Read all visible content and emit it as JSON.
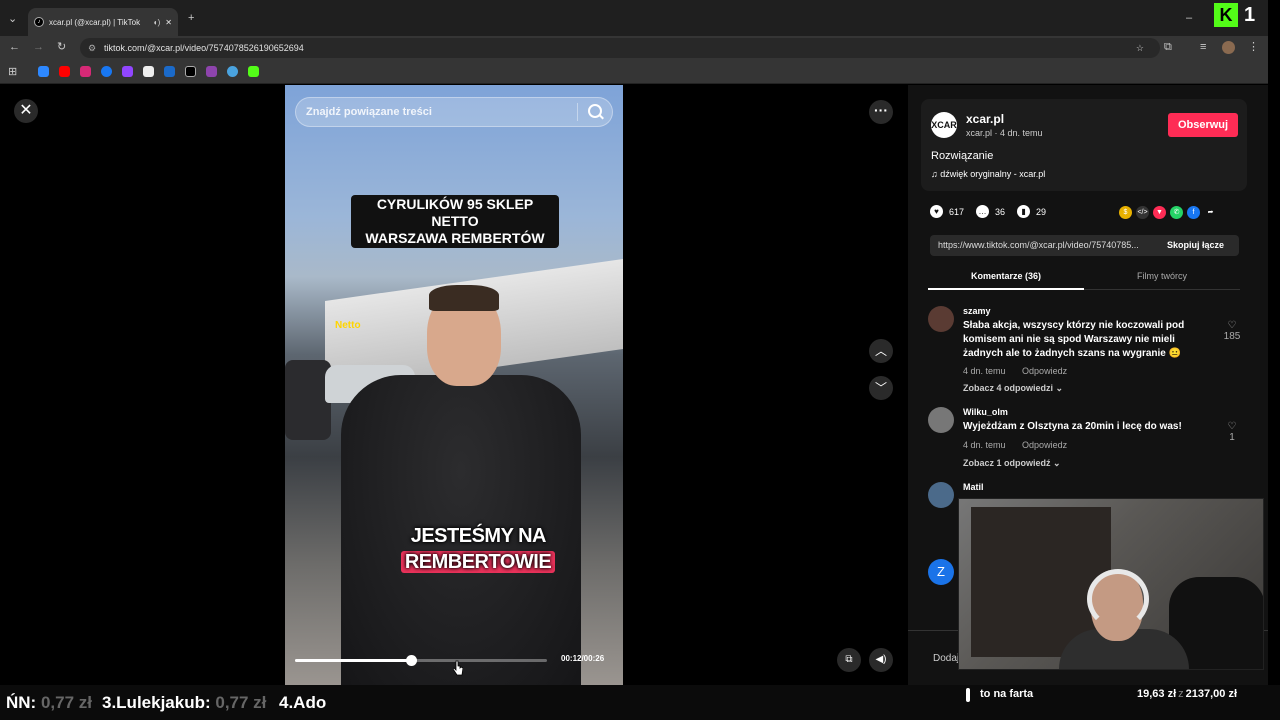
{
  "browser": {
    "tab_title": "xcar.pl (@xcar.pl) | TikTok",
    "url": "tiktok.com/@xcar.pl/video/7574078526190652694",
    "window_buttons": {
      "minimize": "–",
      "close": "✕"
    },
    "new_tab": "+",
    "overlay_logo": "K",
    "overlay_number": "1"
  },
  "video": {
    "search_placeholder": "Znajdź powiązane treści",
    "caption_top": "CYRULIKÓW 95 SKLEP NETTO\nWARSZAWA REMBERTÓW",
    "caption_bottom_a": "JESTEŚMY NA",
    "caption_bottom_b": "REMBERTOWIE",
    "store_sign": "Netto",
    "timecode": "00:12/00:26",
    "progress": 0.46
  },
  "panel": {
    "author_avatar_text": "XCAR",
    "author_name": "xcar.pl",
    "author_meta": "xcar.pl · 4 dn. temu",
    "follow_label": "Obserwuj",
    "description": "Rozwiązanie",
    "music": "♫  dźwięk oryginalny - xcar.pl",
    "likes": "617",
    "comments_count": "36",
    "saves": "29",
    "link": "https://www.tiktok.com/@xcar.pl/video/75740785...",
    "copy_link_label": "Skopiuj łącze",
    "tab_comments": "Komentarze (36)",
    "tab_creator": "Filmy twórcy",
    "comments": [
      {
        "user": "szamy",
        "text": "Słaba akcja, wszyscy którzy nie koczowali pod komisem ani nie są spod Warszawy nie mieli żadnych ale to żadnych szans na wygranie 😐",
        "time": "4 dn. temu",
        "reply": "Odpowiedz",
        "replies": "Zobacz 4 odpowiedzi ⌄",
        "likes": "185"
      },
      {
        "user": "Wilku_olm",
        "text": "Wyjeżdżam z Olsztyna za 20min i lecę do was!",
        "time": "4 dn. temu",
        "reply": "Odpowiedz",
        "replies": "Zobacz 1 odpowiedź ⌄",
        "likes": "1"
      },
      {
        "user": "Matil"
      }
    ],
    "z_avatar": "Z",
    "add_comment": "Dodaj"
  },
  "stream_overlay": {
    "leaderboard": [
      {
        "name": "ŃN:",
        "amount": "0,77 zł"
      },
      {
        "name": "3.Lulekjakub:",
        "amount": "0,77 zł"
      },
      {
        "name": "4.Ado",
        "amount": ""
      }
    ],
    "goal_label": "to na farta",
    "goal_current": "19,63 zł",
    "goal_sep": "z",
    "goal_target": "2137,00 zł"
  },
  "colors": {
    "follow": "#fe2c55",
    "caption_highlight": "#e8325a",
    "kick_green": "#53fc18"
  }
}
